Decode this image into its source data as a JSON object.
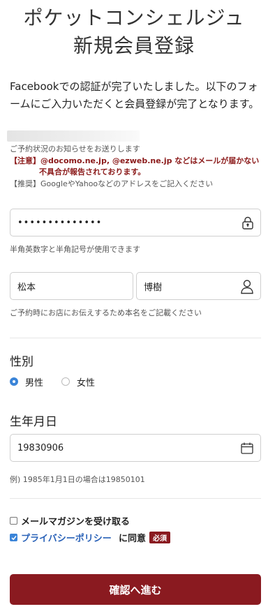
{
  "header": {
    "line1": "ポケットコンシェルジュ",
    "line2": "新規会員登録"
  },
  "intro": {
    "text": "Facebookでの認証が完了いたしました。以下のフォームにご入力いただくと会員登録が完了となります。"
  },
  "email_notice": {
    "line1": "ご予約状況のお知らせをお送りします",
    "caution_prefix": "【注意】",
    "caution_line1": "@docomo.ne.jp, @ezweb.ne.jp などはメールが届かない",
    "caution_line2": "不具合が報告されております。",
    "recommend_prefix": "【推奨】",
    "recommend_text": "GoogleやYahooなどのアドレスをご記入ください"
  },
  "password": {
    "value": "••••••••••••••",
    "help": "半角英数字と半角記号が使用できます",
    "icon": "lock-icon"
  },
  "name": {
    "last": "松本",
    "first": "博樹",
    "help": "ご予約時にお店にお伝えするため本名をご記載ください",
    "icon": "person-icon"
  },
  "gender": {
    "label": "性別",
    "options": [
      "男性",
      "女性"
    ],
    "selected": "男性"
  },
  "birthday": {
    "label": "生年月日",
    "value": "19830906",
    "help": "例) 1985年1月1日の場合は19850101",
    "icon": "calendar-icon"
  },
  "newsletter": {
    "label": "メールマガジンを受け取る",
    "checked": false
  },
  "privacy": {
    "link": "プライバシーポリシー",
    "suffix": "に同意",
    "badge": "必須",
    "checked": true
  },
  "submit": {
    "label": "確認へ進む"
  },
  "colors": {
    "brand": "#8a1a20",
    "radio_selected": "#3a84d8",
    "link": "#2a62b8"
  }
}
